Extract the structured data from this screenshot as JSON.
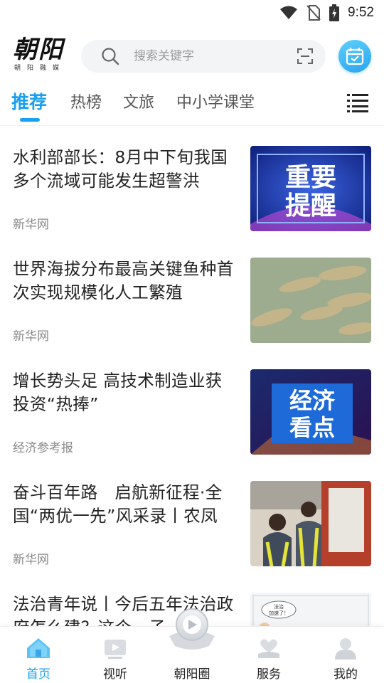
{
  "status_bar": {
    "time": "9:52"
  },
  "header": {
    "logo_main": "朝阳",
    "logo_sub": "朝阳融媒",
    "search_placeholder": "搜索关键字"
  },
  "tabs": [
    {
      "label": "推荐",
      "active": true
    },
    {
      "label": "热榜",
      "active": false
    },
    {
      "label": "文旅",
      "active": false
    },
    {
      "label": "中小学课堂",
      "active": false
    }
  ],
  "articles": [
    {
      "title": "水利部部长：8月中下旬我国多个流域可能发生超警洪",
      "source": "新华网",
      "thumb_text": [
        "重要",
        "提醒"
      ]
    },
    {
      "title": "世界海拔分布最高关键鱼种首次实现规模化人工繁殖",
      "source": "新华网"
    },
    {
      "title": "增长势头足 高技术制造业获投资“热捧”",
      "source": "经济参考报",
      "thumb_text": [
        "经济",
        "看点"
      ]
    },
    {
      "title": "奋斗百年路　启航新征程·全国“两优一先”风采录丨农凤",
      "source": "新华网"
    },
    {
      "title": "法治青年说丨今后五年法治政府怎么建？这个…子",
      "source": "",
      "thumb_text": [
        "法治",
        "加速了！"
      ]
    }
  ],
  "bottom_nav": [
    {
      "label": "首页",
      "icon": "home-icon",
      "active": true
    },
    {
      "label": "视听",
      "icon": "video-icon",
      "active": false
    },
    {
      "label": "朝阳圈",
      "icon": "circle-icon",
      "active": false
    },
    {
      "label": "服务",
      "icon": "service-icon",
      "active": false
    },
    {
      "label": "我的",
      "icon": "profile-icon",
      "active": false
    }
  ],
  "colors": {
    "accent": "#1aa0f0",
    "text": "#222222",
    "muted": "#8a8a8a"
  }
}
